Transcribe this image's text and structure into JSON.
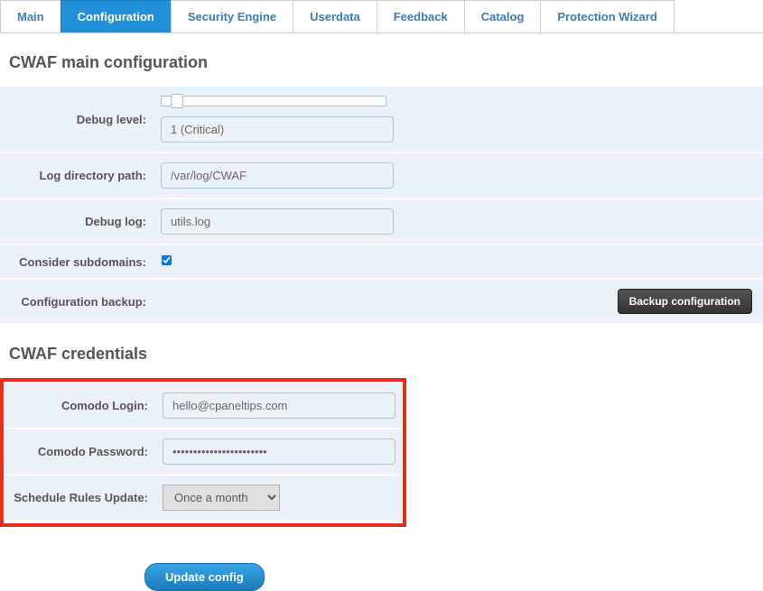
{
  "tabs": {
    "main": "Main",
    "configuration": "Configuration",
    "security_engine": "Security Engine",
    "userdata": "Userdata",
    "feedback": "Feedback",
    "catalog": "Catalog",
    "protection_wizard": "Protection Wizard"
  },
  "section1": {
    "title": "CWAF main configuration",
    "debug_level_label": "Debug level:",
    "debug_level_value": "1 (Critical)",
    "log_dir_label": "Log directory path:",
    "log_dir_value": "/var/log/CWAF",
    "debug_log_label": "Debug log:",
    "debug_log_value": "utils.log",
    "subdomains_label": "Consider subdomains:",
    "backup_label": "Configuration backup:",
    "backup_button": "Backup configuration"
  },
  "section2": {
    "title": "CWAF credentials",
    "login_label": "Comodo Login:",
    "login_value": "hello@cpaneltips.com",
    "password_label": "Comodo Password:",
    "password_value": "•••••••••••••••••••••••",
    "schedule_label": "Schedule Rules Update:",
    "schedule_value": "Once a month"
  },
  "update_button": "Update config"
}
